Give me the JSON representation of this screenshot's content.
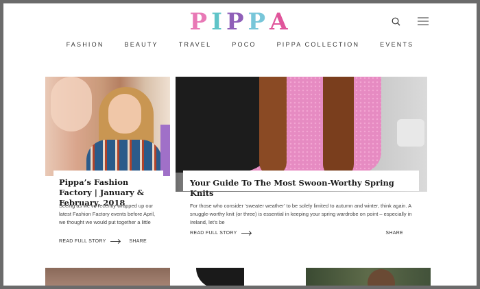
{
  "header": {
    "logo_text": "PIPPA",
    "logo_letters": [
      "P",
      "I",
      "P",
      "P",
      "A"
    ],
    "logo_colors": [
      "#e879b6",
      "#5fc4c8",
      "#8f5fb8",
      "#78c6d9",
      "#e0559b"
    ],
    "icons": [
      "search-icon",
      "menu-icon"
    ]
  },
  "nav": {
    "items": [
      "FASHION",
      "BEAUTY",
      "TRAVEL",
      "POCO",
      "PIPPA COLLECTION",
      "EVENTS"
    ]
  },
  "cards": [
    {
      "title": "Pippa’s Fashion Factory | January & February, 2018",
      "excerpt": "Seeing as we’ve recently wrapped up our latest Fashion Factory events before April, we thought we would put together a little",
      "read_label": "READ FULL STORY",
      "share_label": "SHARE"
    },
    {
      "title": "Your Guide To The Most Swoon-Worthy Spring Knits",
      "excerpt": "For those who consider ‘sweater weather’ to be solely limited to autumn and winter, think again. A snuggle-worthy knit (or three) is essential in keeping your spring wardrobe on point – especially in Ireland, let’s be",
      "read_label": "READ FULL STORY",
      "share_label": "SHARE"
    }
  ]
}
